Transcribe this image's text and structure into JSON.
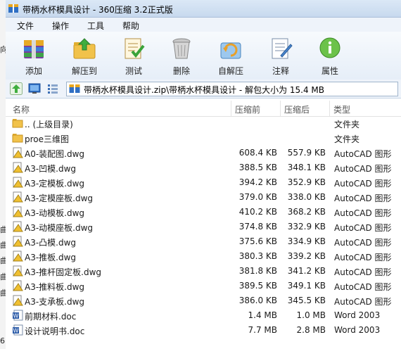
{
  "window": {
    "title": "带柄水杯模具设计 - 360压缩 3.2正式版"
  },
  "colors": {
    "accent": "#c7d9ee",
    "folder": "#f1c24a",
    "acad": "#f0c030",
    "word": "#2a5aa8"
  },
  "menu": [
    "文件",
    "操作",
    "工具",
    "帮助"
  ],
  "toolbar": [
    {
      "label": "添加",
      "icon": "add-archive-icon"
    },
    {
      "label": "解压到",
      "icon": "extract-to-icon"
    },
    {
      "label": "测试",
      "icon": "test-icon"
    },
    {
      "label": "删除",
      "icon": "delete-icon"
    },
    {
      "label": "自解压",
      "icon": "self-extract-icon"
    },
    {
      "label": "注释",
      "icon": "comment-icon"
    },
    {
      "label": "属性",
      "icon": "info-icon"
    }
  ],
  "address": {
    "path": "带柄水杯模具设计.zip\\带柄水杯模具设计 - 解包大小为 15.4 MB"
  },
  "columns": {
    "name": "名称",
    "size": "压缩前",
    "csize": "压缩后",
    "type": "类型"
  },
  "files": [
    {
      "name": ".. (上级目录)",
      "size": "",
      "csize": "",
      "type": "文件夹",
      "icon": "folder-icon"
    },
    {
      "name": "proe三维图",
      "size": "",
      "csize": "",
      "type": "文件夹",
      "icon": "folder-icon"
    },
    {
      "name": "A0-装配图.dwg",
      "size": "608.4 KB",
      "csize": "557.9 KB",
      "type": "AutoCAD 图形",
      "icon": "autocad-file-icon"
    },
    {
      "name": "A3-凹模.dwg",
      "size": "388.5 KB",
      "csize": "348.1 KB",
      "type": "AutoCAD 图形",
      "icon": "autocad-file-icon"
    },
    {
      "name": "A3-定模板.dwg",
      "size": "394.2 KB",
      "csize": "352.9 KB",
      "type": "AutoCAD 图形",
      "icon": "autocad-file-icon"
    },
    {
      "name": "A3-定模座板.dwg",
      "size": "379.0 KB",
      "csize": "338.0 KB",
      "type": "AutoCAD 图形",
      "icon": "autocad-file-icon"
    },
    {
      "name": "A3-动模板.dwg",
      "size": "410.2 KB",
      "csize": "368.2 KB",
      "type": "AutoCAD 图形",
      "icon": "autocad-file-icon"
    },
    {
      "name": "A3-动模座板.dwg",
      "size": "374.8 KB",
      "csize": "332.9 KB",
      "type": "AutoCAD 图形",
      "icon": "autocad-file-icon"
    },
    {
      "name": "A3-凸模.dwg",
      "size": "375.6 KB",
      "csize": "334.9 KB",
      "type": "AutoCAD 图形",
      "icon": "autocad-file-icon"
    },
    {
      "name": "A3-推板.dwg",
      "size": "380.3 KB",
      "csize": "339.2 KB",
      "type": "AutoCAD 图形",
      "icon": "autocad-file-icon"
    },
    {
      "name": "A3-推杆固定板.dwg",
      "size": "381.8 KB",
      "csize": "341.2 KB",
      "type": "AutoCAD 图形",
      "icon": "autocad-file-icon"
    },
    {
      "name": "A3-推料板.dwg",
      "size": "389.5 KB",
      "csize": "349.1 KB",
      "type": "AutoCAD 图形",
      "icon": "autocad-file-icon"
    },
    {
      "name": "A3-支承板.dwg",
      "size": "386.0 KB",
      "csize": "345.5 KB",
      "type": "AutoCAD 图形",
      "icon": "autocad-file-icon"
    },
    {
      "name": "前期材料.doc",
      "size": "1.4 MB",
      "csize": "1.0 MB",
      "type": "Word 2003",
      "icon": "word-doc-icon"
    },
    {
      "name": "设计说明书.doc",
      "size": "7.7 MB",
      "csize": "2.8 MB",
      "type": "Word 2003",
      "icon": "word-doc-icon"
    }
  ],
  "background_strip": [
    "向",
    "曲",
    "曲",
    "曲",
    "曲",
    "曲",
    "6"
  ]
}
